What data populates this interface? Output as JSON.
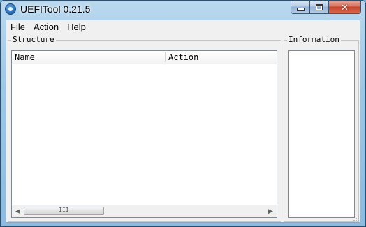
{
  "window": {
    "title": "UEFITool 0.21.5",
    "caption_buttons": {
      "minimize": "–",
      "maximize": "□",
      "close": "✕"
    },
    "icons": {
      "app": "uefitool-app-icon"
    },
    "colors": {
      "frame": "#9cc6e6",
      "client": "#f0f0f0",
      "close_button": "#c5432b"
    }
  },
  "menubar": {
    "items": [
      {
        "label": "File"
      },
      {
        "label": "Action"
      },
      {
        "label": "Help"
      }
    ]
  },
  "structure": {
    "title": "Structure",
    "columns": [
      {
        "label": "Name"
      },
      {
        "label": "Action"
      }
    ],
    "rows": [],
    "scrollbar": {
      "thumb_grip": "III",
      "left_arrow": "◀",
      "right_arrow": "▶"
    }
  },
  "information": {
    "title": "Information",
    "content": ""
  }
}
